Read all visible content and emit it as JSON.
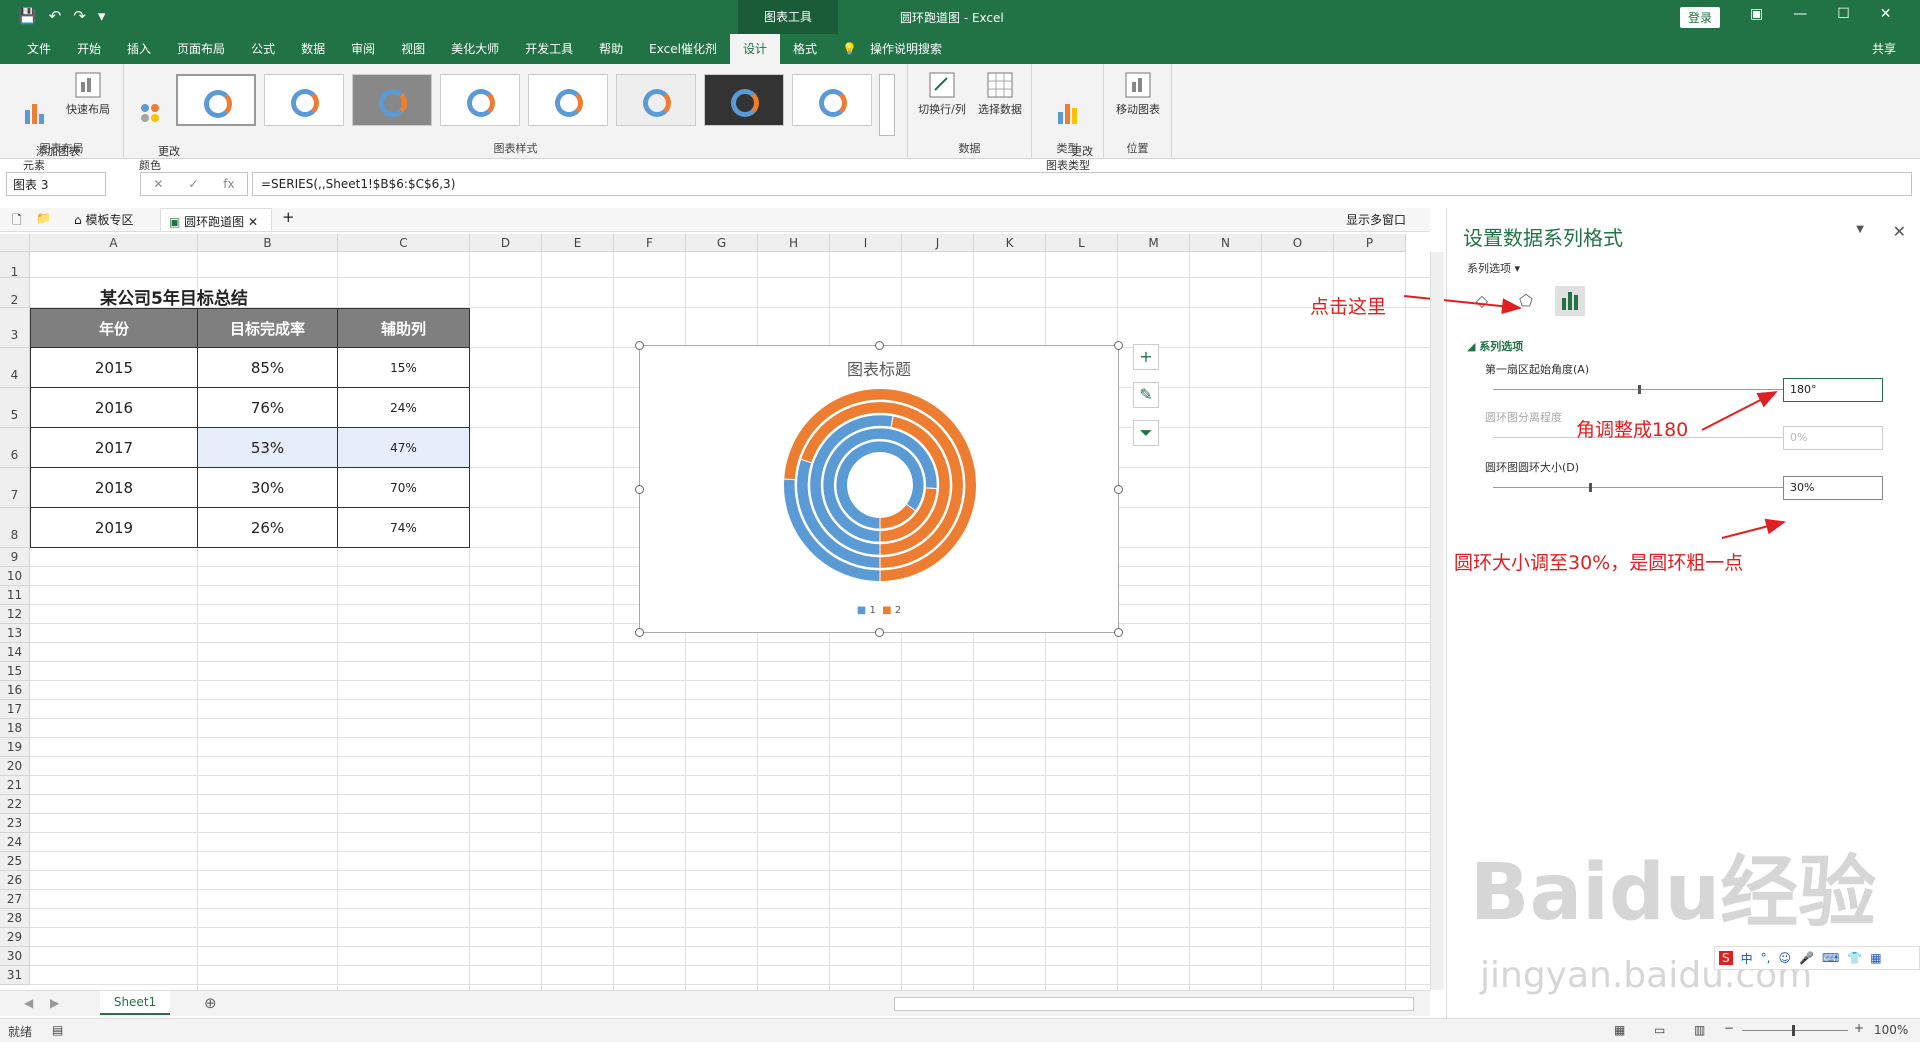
{
  "titlebar": {
    "context_tab": "图表工具",
    "doc_title": "圆环跑道图 - Excel",
    "login": "登录"
  },
  "tabs": [
    {
      "label": "文件"
    },
    {
      "label": "开始"
    },
    {
      "label": "插入"
    },
    {
      "label": "页面布局"
    },
    {
      "label": "公式"
    },
    {
      "label": "数据"
    },
    {
      "label": "审阅"
    },
    {
      "label": "视图"
    },
    {
      "label": "美化大师"
    },
    {
      "label": "开发工具"
    },
    {
      "label": "帮助"
    },
    {
      "label": "Excel催化剂"
    },
    {
      "label": "设计"
    },
    {
      "label": "格式"
    }
  ],
  "tell_me": "操作说明搜索",
  "share": "共享",
  "ribbon": {
    "add_element": "添加图表\n元素",
    "quick_layout": "快速布局",
    "layout_group": "图表布局",
    "change_colors": "更改\n颜色",
    "styles_group": "图表样式",
    "switch_row_col": "切换行/列",
    "select_data": "选择数据",
    "data_group": "数据",
    "change_type": "更改\n图表类型",
    "type_group": "类型",
    "move_chart": "移动图表",
    "location_group": "位置"
  },
  "formula_bar": {
    "name_box": "图表 3",
    "formula": "=SERIES(,,Sheet1!$B$6:$C$6,3)"
  },
  "tabstrip": {
    "templates": "模板专区",
    "doc": "圆环跑道图",
    "multi_window": "显示多窗口"
  },
  "columns": [
    "A",
    "B",
    "C",
    "D",
    "E",
    "F",
    "G",
    "H",
    "I",
    "J",
    "K",
    "L",
    "M",
    "N",
    "O",
    "P"
  ],
  "rows": [
    "1",
    "2",
    "3",
    "4",
    "5",
    "6",
    "7",
    "8",
    "9",
    "10",
    "11",
    "12",
    "13",
    "14",
    "15",
    "16",
    "17",
    "18",
    "19",
    "20",
    "21",
    "22",
    "23",
    "24",
    "25",
    "26",
    "27",
    "28",
    "29",
    "30",
    "31"
  ],
  "sheet": {
    "title": "某公司5年目标总结",
    "headers": [
      "年份",
      "目标完成率",
      "辅助列"
    ],
    "data": [
      [
        "2015",
        "85%",
        "15%"
      ],
      [
        "2016",
        "76%",
        "24%"
      ],
      [
        "2017",
        "53%",
        "47%"
      ],
      [
        "2018",
        "30%",
        "70%"
      ],
      [
        "2019",
        "26%",
        "74%"
      ]
    ]
  },
  "chart": {
    "title": "图表标题",
    "legend": [
      "1",
      "2"
    ],
    "colors": {
      "s1": "#5b9bd5",
      "s2": "#ed7d31"
    }
  },
  "chart_data": {
    "type": "doughnut",
    "title": "图表标题",
    "rings": [
      {
        "year": "2015",
        "values": [
          85,
          15
        ]
      },
      {
        "year": "2016",
        "values": [
          76,
          24
        ]
      },
      {
        "year": "2017",
        "values": [
          53,
          47
        ]
      },
      {
        "year": "2018",
        "values": [
          30,
          70
        ]
      },
      {
        "year": "2019",
        "values": [
          26,
          74
        ]
      }
    ],
    "first_slice_angle": 180,
    "hole_size_percent": 30
  },
  "pane": {
    "title": "设置数据系列格式",
    "sub": "系列选项",
    "section": "系列选项",
    "angle_label": "第一扇区起始角度(A)",
    "angle_value": "180°",
    "explode_label": "圆环图分离程度",
    "explode_value": "0%",
    "hole_label": "圆环图圆环大小(D)",
    "hole_value": "30%"
  },
  "annotations": {
    "click_here": "点击这里",
    "angle_note": "角调整成180",
    "hole_note": "圆环大小调至30%，是圆环粗一点"
  },
  "sheet_tab": "Sheet1",
  "status": {
    "ready": "就绪",
    "zoom": "100%"
  },
  "watermark": {
    "brand": "Baidu经验",
    "url": "jingyan.baidu.com"
  },
  "ime": {
    "mode": "中"
  }
}
